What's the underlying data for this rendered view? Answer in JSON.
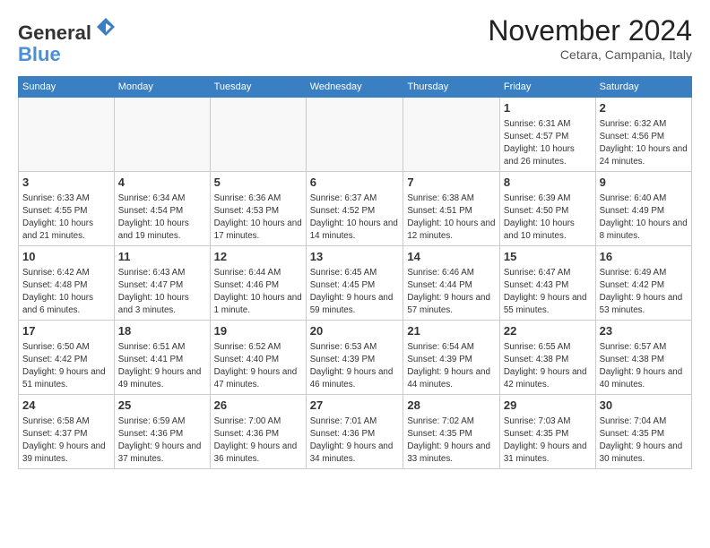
{
  "header": {
    "logo_line1": "General",
    "logo_line2": "Blue",
    "month_title": "November 2024",
    "location": "Cetara, Campania, Italy"
  },
  "weekdays": [
    "Sunday",
    "Monday",
    "Tuesday",
    "Wednesday",
    "Thursday",
    "Friday",
    "Saturday"
  ],
  "weeks": [
    [
      {
        "day": "",
        "info": ""
      },
      {
        "day": "",
        "info": ""
      },
      {
        "day": "",
        "info": ""
      },
      {
        "day": "",
        "info": ""
      },
      {
        "day": "",
        "info": ""
      },
      {
        "day": "1",
        "info": "Sunrise: 6:31 AM\nSunset: 4:57 PM\nDaylight: 10 hours and 26 minutes."
      },
      {
        "day": "2",
        "info": "Sunrise: 6:32 AM\nSunset: 4:56 PM\nDaylight: 10 hours and 24 minutes."
      }
    ],
    [
      {
        "day": "3",
        "info": "Sunrise: 6:33 AM\nSunset: 4:55 PM\nDaylight: 10 hours and 21 minutes."
      },
      {
        "day": "4",
        "info": "Sunrise: 6:34 AM\nSunset: 4:54 PM\nDaylight: 10 hours and 19 minutes."
      },
      {
        "day": "5",
        "info": "Sunrise: 6:36 AM\nSunset: 4:53 PM\nDaylight: 10 hours and 17 minutes."
      },
      {
        "day": "6",
        "info": "Sunrise: 6:37 AM\nSunset: 4:52 PM\nDaylight: 10 hours and 14 minutes."
      },
      {
        "day": "7",
        "info": "Sunrise: 6:38 AM\nSunset: 4:51 PM\nDaylight: 10 hours and 12 minutes."
      },
      {
        "day": "8",
        "info": "Sunrise: 6:39 AM\nSunset: 4:50 PM\nDaylight: 10 hours and 10 minutes."
      },
      {
        "day": "9",
        "info": "Sunrise: 6:40 AM\nSunset: 4:49 PM\nDaylight: 10 hours and 8 minutes."
      }
    ],
    [
      {
        "day": "10",
        "info": "Sunrise: 6:42 AM\nSunset: 4:48 PM\nDaylight: 10 hours and 6 minutes."
      },
      {
        "day": "11",
        "info": "Sunrise: 6:43 AM\nSunset: 4:47 PM\nDaylight: 10 hours and 3 minutes."
      },
      {
        "day": "12",
        "info": "Sunrise: 6:44 AM\nSunset: 4:46 PM\nDaylight: 10 hours and 1 minute."
      },
      {
        "day": "13",
        "info": "Sunrise: 6:45 AM\nSunset: 4:45 PM\nDaylight: 9 hours and 59 minutes."
      },
      {
        "day": "14",
        "info": "Sunrise: 6:46 AM\nSunset: 4:44 PM\nDaylight: 9 hours and 57 minutes."
      },
      {
        "day": "15",
        "info": "Sunrise: 6:47 AM\nSunset: 4:43 PM\nDaylight: 9 hours and 55 minutes."
      },
      {
        "day": "16",
        "info": "Sunrise: 6:49 AM\nSunset: 4:42 PM\nDaylight: 9 hours and 53 minutes."
      }
    ],
    [
      {
        "day": "17",
        "info": "Sunrise: 6:50 AM\nSunset: 4:42 PM\nDaylight: 9 hours and 51 minutes."
      },
      {
        "day": "18",
        "info": "Sunrise: 6:51 AM\nSunset: 4:41 PM\nDaylight: 9 hours and 49 minutes."
      },
      {
        "day": "19",
        "info": "Sunrise: 6:52 AM\nSunset: 4:40 PM\nDaylight: 9 hours and 47 minutes."
      },
      {
        "day": "20",
        "info": "Sunrise: 6:53 AM\nSunset: 4:39 PM\nDaylight: 9 hours and 46 minutes."
      },
      {
        "day": "21",
        "info": "Sunrise: 6:54 AM\nSunset: 4:39 PM\nDaylight: 9 hours and 44 minutes."
      },
      {
        "day": "22",
        "info": "Sunrise: 6:55 AM\nSunset: 4:38 PM\nDaylight: 9 hours and 42 minutes."
      },
      {
        "day": "23",
        "info": "Sunrise: 6:57 AM\nSunset: 4:38 PM\nDaylight: 9 hours and 40 minutes."
      }
    ],
    [
      {
        "day": "24",
        "info": "Sunrise: 6:58 AM\nSunset: 4:37 PM\nDaylight: 9 hours and 39 minutes."
      },
      {
        "day": "25",
        "info": "Sunrise: 6:59 AM\nSunset: 4:36 PM\nDaylight: 9 hours and 37 minutes."
      },
      {
        "day": "26",
        "info": "Sunrise: 7:00 AM\nSunset: 4:36 PM\nDaylight: 9 hours and 36 minutes."
      },
      {
        "day": "27",
        "info": "Sunrise: 7:01 AM\nSunset: 4:36 PM\nDaylight: 9 hours and 34 minutes."
      },
      {
        "day": "28",
        "info": "Sunrise: 7:02 AM\nSunset: 4:35 PM\nDaylight: 9 hours and 33 minutes."
      },
      {
        "day": "29",
        "info": "Sunrise: 7:03 AM\nSunset: 4:35 PM\nDaylight: 9 hours and 31 minutes."
      },
      {
        "day": "30",
        "info": "Sunrise: 7:04 AM\nSunset: 4:35 PM\nDaylight: 9 hours and 30 minutes."
      }
    ]
  ]
}
